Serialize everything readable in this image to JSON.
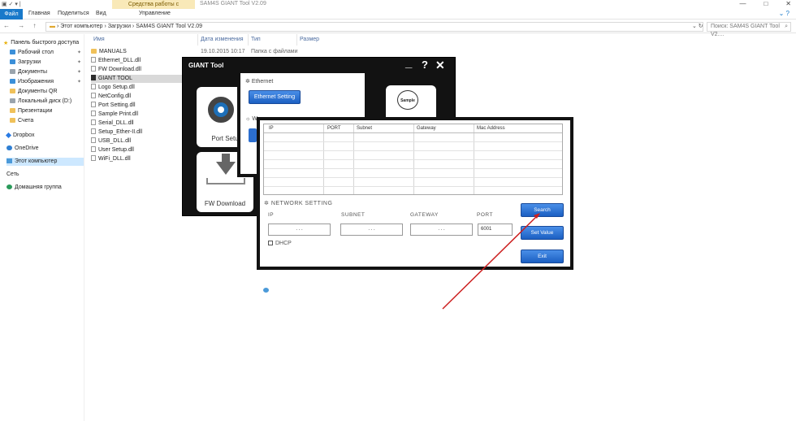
{
  "explorer": {
    "window_title": "SAM4S GIANT Tool V2.09",
    "context_tab": "Средства работы с приложениями",
    "ribbon_tabs": [
      "Файл",
      "Главная",
      "Поделиться",
      "Вид",
      "Управление"
    ],
    "breadcrumb": [
      "Этот компьютер",
      "Загрузки",
      "SAM4S GIANT Tool V2.09"
    ],
    "search_placeholder": "Поиск: SAM4S GIANT Tool V2....",
    "window_buttons": [
      "—",
      "□",
      "✕"
    ],
    "nav_buttons": "← → ↑"
  },
  "navpane": {
    "items": [
      {
        "label": "Панель быстрого доступа",
        "icon": "star-icon"
      },
      {
        "label": "Рабочий стол",
        "icon": "desktop-icon",
        "pinned": true
      },
      {
        "label": "Загрузки",
        "icon": "downloads-icon",
        "pinned": true
      },
      {
        "label": "Документы",
        "icon": "documents-icon",
        "pinned": true
      },
      {
        "label": "Изображения",
        "icon": "pictures-icon",
        "pinned": true
      },
      {
        "label": "Документы QR",
        "icon": "folder-icon"
      },
      {
        "label": "Локальный диск (D:)",
        "icon": "drive-icon"
      },
      {
        "label": "Презентации",
        "icon": "folder-icon"
      },
      {
        "label": "Счета",
        "icon": "folder-icon"
      },
      {
        "label": "Dropbox",
        "icon": "dropbox-icon"
      },
      {
        "label": "OneDrive",
        "icon": "onedrive-icon"
      },
      {
        "label": "Этот компьютер",
        "icon": "computer-icon",
        "selected": true
      },
      {
        "label": "Сеть",
        "icon": "network-icon"
      },
      {
        "label": "Домашняя группа",
        "icon": "homegroup-icon"
      }
    ],
    "pin_glyph": "✦"
  },
  "filelist": {
    "columns": [
      "Имя",
      "Дата изменения",
      "Тип",
      "Размер"
    ],
    "files": [
      {
        "name": "MANUALS",
        "date": "19.10.2015 10:17",
        "type": "Папка с файлами",
        "kind": "folder"
      },
      {
        "name": "Ethernet_DLL.dll",
        "kind": "dll"
      },
      {
        "name": "FW Download.dll",
        "kind": "dll"
      },
      {
        "name": "GIANT TOOL",
        "kind": "exe",
        "selected": true
      },
      {
        "name": "Logo Setup.dll",
        "kind": "dll"
      },
      {
        "name": "NetConfig.dll",
        "kind": "dll"
      },
      {
        "name": "Port Setting.dll",
        "kind": "dll"
      },
      {
        "name": "Sample Print.dll",
        "kind": "dll"
      },
      {
        "name": "Serial_DLL.dll",
        "kind": "dll"
      },
      {
        "name": "Setup_Ether-II.dll",
        "kind": "dll"
      },
      {
        "name": "USB_DLL.dll",
        "kind": "dll"
      },
      {
        "name": "User Setup.dll",
        "kind": "dll"
      },
      {
        "name": "WiFi_DLL.dll",
        "kind": "dll"
      }
    ]
  },
  "giant_tool": {
    "title": "GIANT Tool",
    "minimize": "_",
    "help": "?",
    "close": "✕",
    "tiles": {
      "port_setup": "Port Setu",
      "fw_download": "FW Download",
      "sample_icon_text": "Sample"
    }
  },
  "ethernet_dialog": {
    "header": "Ethernet",
    "button": "Ethernet Setting",
    "partial_header": "W"
  },
  "network_dialog": {
    "grid_headers": [
      "IP",
      "PORT",
      "Subnet",
      "Gateway",
      "Mac Address"
    ],
    "section_title": "NETWORK SETTING",
    "labels": {
      "ip": "IP",
      "subnet": "SUBNET",
      "gateway": "GATEWAY",
      "port": "PORT"
    },
    "values": {
      "ip": ".   .   .",
      "subnet": ".   .   .",
      "gateway": ".   .   .",
      "port": "6001"
    },
    "dhcp_label": "DHCP",
    "buttons": {
      "search": "Search",
      "set_value": "Set Value",
      "exit": "Exit"
    }
  },
  "annotation": {
    "arrow_color": "#cc1f1f"
  }
}
